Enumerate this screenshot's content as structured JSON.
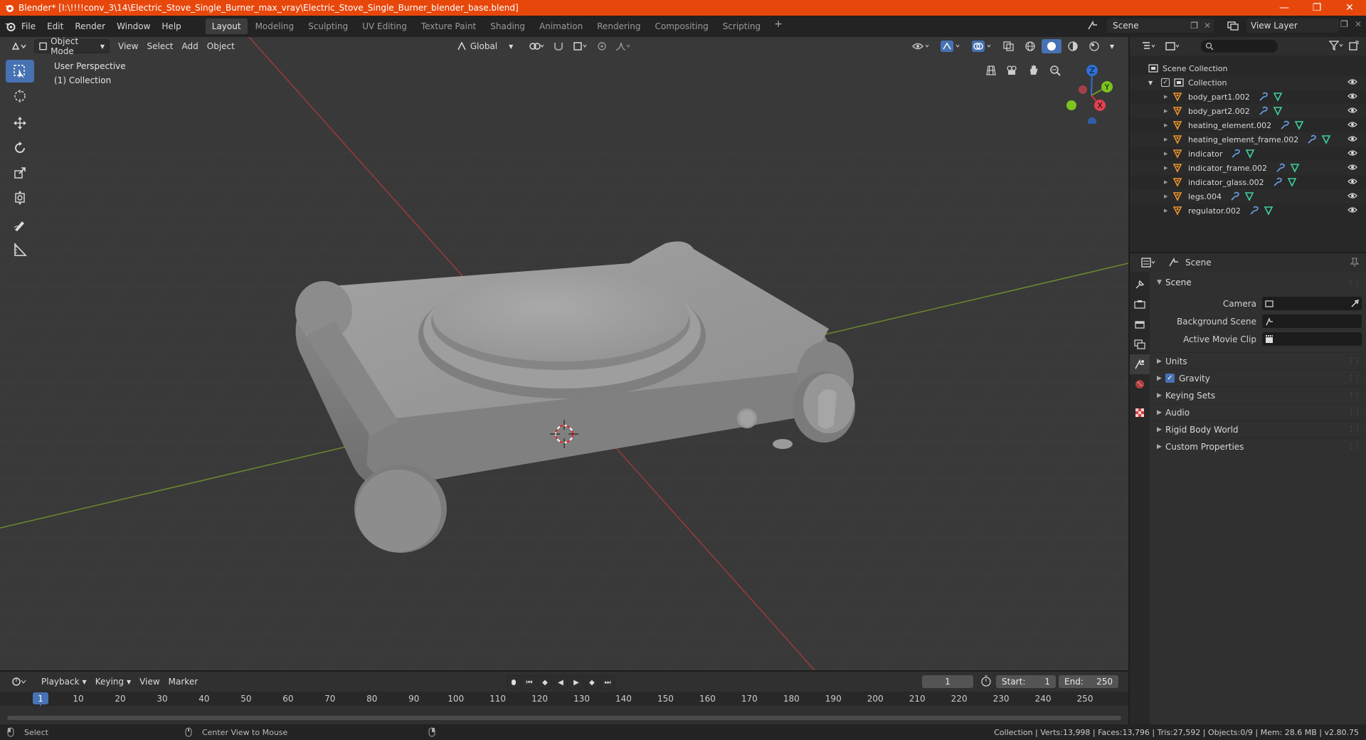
{
  "window": {
    "title": "Blender* [I:\\!!!!conv_3\\14\\Electric_Stove_Single_Burner_max_vray\\Electric_Stove_Single_Burner_blender_base.blend]",
    "controls": [
      "—",
      "❐",
      "✕"
    ]
  },
  "menubar": {
    "items": [
      "File",
      "Edit",
      "Render",
      "Window",
      "Help"
    ],
    "workspaces": [
      "Layout",
      "Modeling",
      "Sculpting",
      "UV Editing",
      "Texture Paint",
      "Shading",
      "Animation",
      "Rendering",
      "Compositing",
      "Scripting"
    ],
    "active_workspace": "Layout",
    "scene_name": "Scene",
    "view_layer": "View Layer"
  },
  "viewport": {
    "mode": "Object Mode",
    "menus": [
      "View",
      "Select",
      "Add",
      "Object"
    ],
    "transform_orientation": "Global",
    "overlay_title": "User Perspective",
    "overlay_collection": "(1) Collection",
    "gizmo_labels": {
      "x": "X",
      "y": "Y",
      "z": "Z"
    },
    "colors": {
      "background": "#393939",
      "x_axis": "#9c3a3a",
      "y_axis": "#6b8a2e",
      "active_tool": "#4772b3",
      "header_accent": "#e8470b"
    }
  },
  "timeline": {
    "menus": [
      "Playback",
      "Keying",
      "View",
      "Marker"
    ],
    "current_frame": "1",
    "start_label": "Start:",
    "start": "1",
    "end_label": "End:",
    "end": "250",
    "ticks": [
      "1",
      "10",
      "20",
      "30",
      "40",
      "50",
      "60",
      "70",
      "80",
      "90",
      "100",
      "110",
      "120",
      "130",
      "140",
      "150",
      "160",
      "170",
      "180",
      "190",
      "200",
      "210",
      "220",
      "230",
      "240",
      "250"
    ]
  },
  "statusbar": {
    "select": "Select",
    "center_view": "Center View to Mouse",
    "stats": "Collection | Verts:13,998 | Faces:13,796 | Tris:27,592 | Objects:0/9 | Mem: 28.6 MB | v2.80.75"
  },
  "outliner": {
    "root": "Scene Collection",
    "collection": "Collection",
    "objects": [
      "body_part1.002",
      "body_part2.002",
      "heating_element.002",
      "heating_element_frame.002",
      "indicator",
      "indicator_frame.002",
      "indicator_glass.002",
      "legs.004",
      "regulator.002"
    ]
  },
  "properties": {
    "context": "Scene",
    "panel": "Scene",
    "fields": [
      {
        "label": "Camera"
      },
      {
        "label": "Background Scene"
      },
      {
        "label": "Active Movie Clip"
      }
    ],
    "subpanels": [
      "Units",
      "Gravity",
      "Keying Sets",
      "Audio",
      "Rigid Body World",
      "Custom Properties"
    ]
  }
}
